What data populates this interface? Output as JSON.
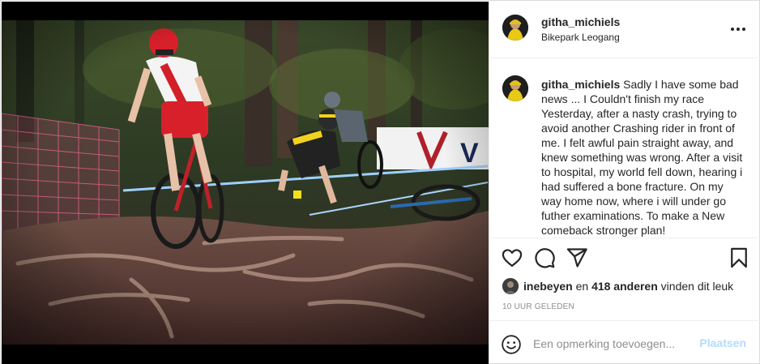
{
  "post": {
    "photo_alt": "Mountain bike race on a rooty forest trail",
    "banner_text": "V"
  },
  "header": {
    "username": "githa_michiels",
    "location": "Bikepark Leogang",
    "more_icon": "more-horizontal-icon"
  },
  "caption": {
    "username": "githa_michiels",
    "text": "Sadly I have some bad news ... I Couldn't finish my race Yesterday, after a nasty crash, trying to avoid another Crashing rider in front of me. I felt awful pain straight away, and knew something was wrong. After a visit to hospital, my world fell down, hearing i had suffered a bone fracture. On my way home now, where i will under go futher examinations. To make a New comeback stronger plan!"
  },
  "actions": {
    "like_icon": "heart-icon",
    "comment_icon": "comment-icon",
    "share_icon": "send-icon",
    "save_icon": "bookmark-icon"
  },
  "likes": {
    "first_user": "inebeyen",
    "connector": " en ",
    "others": "418 anderen",
    "suffix": " vinden dit leuk"
  },
  "timestamp": "10 uur geleden",
  "comment_bar": {
    "emoji_icon": "smiley-icon",
    "placeholder": "Een opmerking toevoegen...",
    "post_label": "Plaatsen"
  },
  "colors": {
    "border": "#dbdbdb",
    "text": "#262626",
    "secondary": "#8e8e8e",
    "post_disabled": "#b3dbff"
  }
}
